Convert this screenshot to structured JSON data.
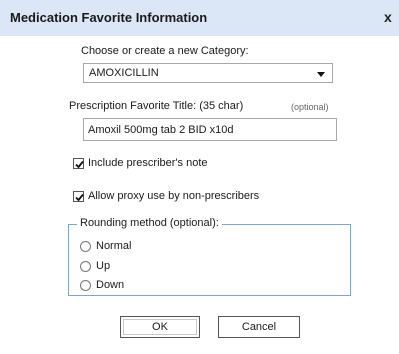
{
  "dialog": {
    "title": "Medication Favorite Information",
    "close_glyph": "x",
    "close_icon": "close-icon"
  },
  "category": {
    "label": "Choose or create a new Category:",
    "selected": "AMOXICILLIN",
    "arrow_icon": "chevron-down-icon"
  },
  "favorite_title": {
    "label": "Prescription Favorite Title:  (35 char)",
    "optional": "(optional)",
    "value": "Amoxil 500mg tab 2 BID x10d"
  },
  "checkboxes": [
    {
      "label": "Include prescriber's note",
      "checked": true
    },
    {
      "label": "Allow proxy use by non-prescribers",
      "checked": true
    }
  ],
  "rounding": {
    "legend": "Rounding method (optional):",
    "options": [
      "Normal",
      "Up",
      "Down"
    ],
    "selected": null
  },
  "buttons": {
    "ok": "OK",
    "cancel": "Cancel"
  },
  "colors": {
    "titlebar": "#dbe6f6",
    "fieldset_border": "#7fa7c9"
  }
}
